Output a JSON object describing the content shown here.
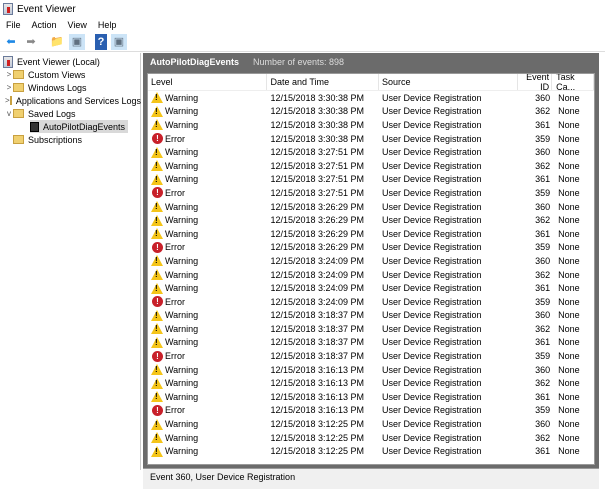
{
  "window": {
    "title": "Event Viewer"
  },
  "menu": [
    "File",
    "Action",
    "View",
    "Help"
  ],
  "toolbar": [
    {
      "name": "back-icon",
      "glyph": "⬅",
      "color": "#1e88e5"
    },
    {
      "name": "forward-icon",
      "glyph": "➡",
      "color": "#888"
    },
    {
      "name": "up-folder-icon",
      "glyph": "📁",
      "color": "#c8a040"
    },
    {
      "name": "show-hide-tree-icon",
      "glyph": "▣",
      "color": "#607080"
    },
    {
      "name": "help-icon",
      "glyph": "?",
      "color": "#fff"
    },
    {
      "name": "show-hide-action-pane-icon",
      "glyph": "▣",
      "color": "#607080"
    }
  ],
  "tree": {
    "root": "Event Viewer (Local)",
    "items": [
      {
        "label": "Custom Views",
        "chevron": ">"
      },
      {
        "label": "Windows Logs",
        "chevron": ">"
      },
      {
        "label": "Applications and Services Logs",
        "chevron": ">"
      },
      {
        "label": "Saved Logs",
        "chevron": "v"
      }
    ],
    "saved_child": "AutoPilotDiagEvents",
    "subscriptions": "Subscriptions"
  },
  "log": {
    "name": "AutoPilotDiagEvents",
    "count_label": "Number of events: 898"
  },
  "columns": [
    "Level",
    "Date and Time",
    "Source",
    "Event ID",
    "Task Ca..."
  ],
  "rows": [
    [
      "Warning",
      "12/15/2018 3:30:38 PM",
      "User Device Registration",
      "360",
      "None"
    ],
    [
      "Warning",
      "12/15/2018 3:30:38 PM",
      "User Device Registration",
      "362",
      "None"
    ],
    [
      "Warning",
      "12/15/2018 3:30:38 PM",
      "User Device Registration",
      "361",
      "None"
    ],
    [
      "Error",
      "12/15/2018 3:30:38 PM",
      "User Device Registration",
      "359",
      "None"
    ],
    [
      "Warning",
      "12/15/2018 3:27:51 PM",
      "User Device Registration",
      "360",
      "None"
    ],
    [
      "Warning",
      "12/15/2018 3:27:51 PM",
      "User Device Registration",
      "362",
      "None"
    ],
    [
      "Warning",
      "12/15/2018 3:27:51 PM",
      "User Device Registration",
      "361",
      "None"
    ],
    [
      "Error",
      "12/15/2018 3:27:51 PM",
      "User Device Registration",
      "359",
      "None"
    ],
    [
      "Warning",
      "12/15/2018 3:26:29 PM",
      "User Device Registration",
      "360",
      "None"
    ],
    [
      "Warning",
      "12/15/2018 3:26:29 PM",
      "User Device Registration",
      "362",
      "None"
    ],
    [
      "Warning",
      "12/15/2018 3:26:29 PM",
      "User Device Registration",
      "361",
      "None"
    ],
    [
      "Error",
      "12/15/2018 3:26:29 PM",
      "User Device Registration",
      "359",
      "None"
    ],
    [
      "Warning",
      "12/15/2018 3:24:09 PM",
      "User Device Registration",
      "360",
      "None"
    ],
    [
      "Warning",
      "12/15/2018 3:24:09 PM",
      "User Device Registration",
      "362",
      "None"
    ],
    [
      "Warning",
      "12/15/2018 3:24:09 PM",
      "User Device Registration",
      "361",
      "None"
    ],
    [
      "Error",
      "12/15/2018 3:24:09 PM",
      "User Device Registration",
      "359",
      "None"
    ],
    [
      "Warning",
      "12/15/2018 3:18:37 PM",
      "User Device Registration",
      "360",
      "None"
    ],
    [
      "Warning",
      "12/15/2018 3:18:37 PM",
      "User Device Registration",
      "362",
      "None"
    ],
    [
      "Warning",
      "12/15/2018 3:18:37 PM",
      "User Device Registration",
      "361",
      "None"
    ],
    [
      "Error",
      "12/15/2018 3:18:37 PM",
      "User Device Registration",
      "359",
      "None"
    ],
    [
      "Warning",
      "12/15/2018 3:16:13 PM",
      "User Device Registration",
      "360",
      "None"
    ],
    [
      "Warning",
      "12/15/2018 3:16:13 PM",
      "User Device Registration",
      "362",
      "None"
    ],
    [
      "Warning",
      "12/15/2018 3:16:13 PM",
      "User Device Registration",
      "361",
      "None"
    ],
    [
      "Error",
      "12/15/2018 3:16:13 PM",
      "User Device Registration",
      "359",
      "None"
    ],
    [
      "Warning",
      "12/15/2018 3:12:25 PM",
      "User Device Registration",
      "360",
      "None"
    ],
    [
      "Warning",
      "12/15/2018 3:12:25 PM",
      "User Device Registration",
      "362",
      "None"
    ],
    [
      "Warning",
      "12/15/2018 3:12:25 PM",
      "User Device Registration",
      "361",
      "None"
    ]
  ],
  "preview": {
    "title": "Event 360, User Device Registration"
  }
}
